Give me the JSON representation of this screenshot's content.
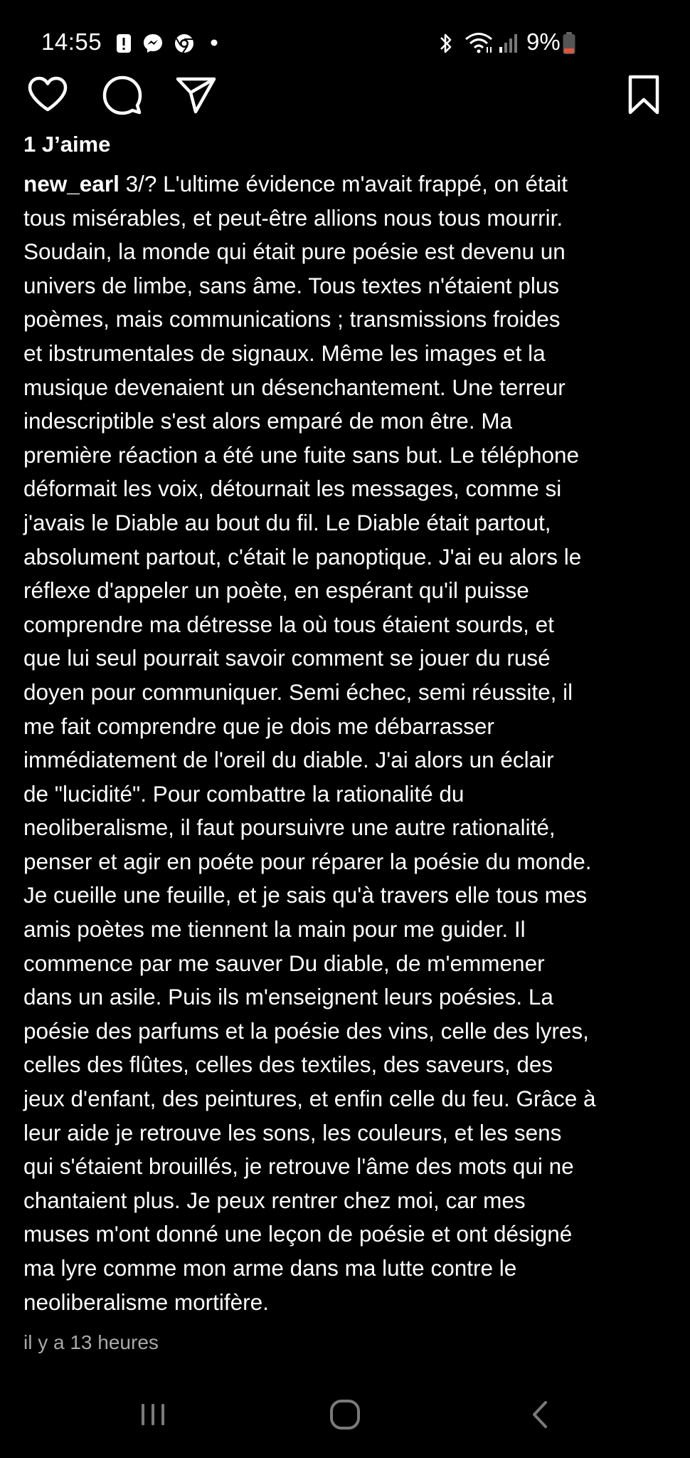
{
  "status_bar": {
    "time": "14:55",
    "battery": "9%",
    "left_icons": [
      "alert-icon",
      "messenger-icon",
      "chrome-icon",
      "dot-icon"
    ],
    "right_icons": [
      "bluetooth-icon",
      "wifi-icon",
      "signal-icon",
      "battery-icon"
    ],
    "battery_color": "#e0563b"
  },
  "actions": {
    "icons": [
      "heart-icon",
      "comment-icon",
      "send-icon",
      "bookmark-icon"
    ]
  },
  "post": {
    "likes": "1 J’aime",
    "username": "new_earl",
    "caption_lines": [
      " 3/? L'ultime évidence m'avait frappé, on était",
      "tous misérables, et peut-être allions nous tous mourrir.",
      "Soudain, la monde qui était pure poésie est devenu un",
      "univers de limbe, sans âme. Tous textes n'étaient plus",
      "poèmes, mais communications ; transmissions froides",
      "et ibstrumentales de signaux. Même les images et la",
      "musique devenaient un désenchantement. Une terreur",
      "indescriptible s'est alors emparé de mon être. Ma",
      "première réaction a été une fuite sans but. Le téléphone",
      "déformait les voix, détournait les messages, comme si",
      "j'avais le Diable au bout du fil. Le Diable était partout,",
      "absolument partout, c'était le panoptique. J'ai eu alors le",
      "réflexe d'appeler un poète, en espérant qu'il puisse",
      "comprendre ma détresse la où tous étaient sourds, et",
      "que lui seul pourrait savoir comment se jouer du rusé",
      "doyen pour communiquer. Semi échec, semi réussite, il",
      "me fait comprendre que je dois me débarrasser",
      "immédiatement de l'oreil du diable. J'ai alors un éclair",
      "de \"lucidité\". Pour combattre la rationalité du",
      "neoliberalisme, il faut poursuivre une autre rationalité,",
      "penser et agir en poéte pour réparer la poésie du monde.",
      "Je cueille une feuille, et je sais qu'à travers elle tous mes",
      "amis poètes me tiennent la main pour me guider. Il",
      "commence par me sauver Du diable, de m'emmener",
      "dans un asile. Puis ils m'enseignent leurs poésies. La",
      "poésie des parfums et la poésie des vins, celle des lyres,",
      "celles des flûtes, celles des textiles, des saveurs, des",
      "jeux d'enfant, des peintures, et enfin celle du feu. Grâce à",
      "leur aide je retrouve les sons, les couleurs, et les sens",
      "qui s'étaient brouillés, je retrouve l'âme des mots qui ne",
      "chantaient plus. Je peux rentrer chez moi, car mes",
      "muses m'ont donné une leçon de poésie et ont désigné",
      "ma lyre comme mon arme dans ma lutte contre le",
      "neoliberalisme mortifère."
    ],
    "timestamp": "il y a 13 heures"
  },
  "nav": {
    "icons": [
      "recent-apps-icon",
      "home-icon",
      "back-icon"
    ]
  }
}
